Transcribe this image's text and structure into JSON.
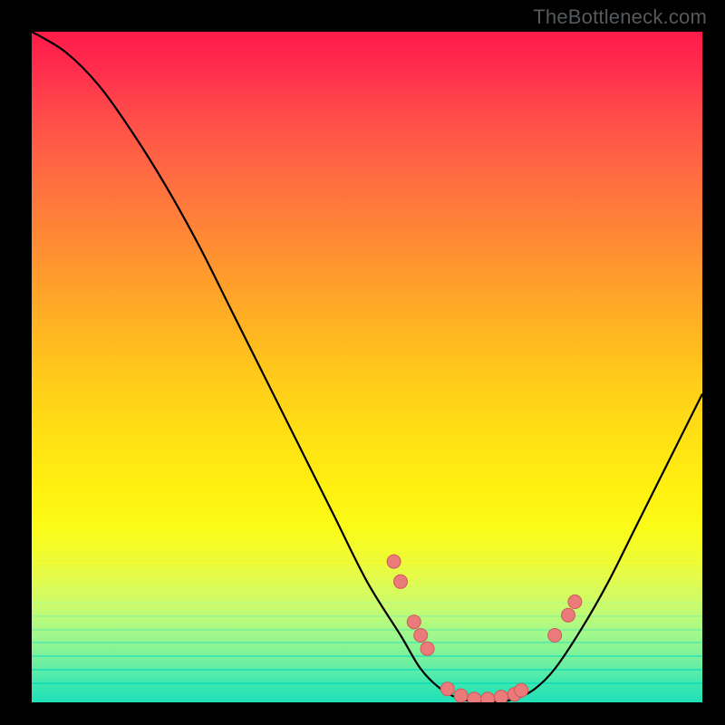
{
  "watermark": "TheBottleneck.com",
  "chart_data": {
    "type": "line",
    "title": "",
    "xlabel": "",
    "ylabel": "",
    "xlim": [
      0,
      100
    ],
    "ylim": [
      0,
      100
    ],
    "grid": false,
    "curve": [
      {
        "x": 0,
        "y": 100
      },
      {
        "x": 5,
        "y": 97
      },
      {
        "x": 10,
        "y": 92
      },
      {
        "x": 15,
        "y": 85
      },
      {
        "x": 20,
        "y": 77
      },
      {
        "x": 25,
        "y": 68
      },
      {
        "x": 30,
        "y": 58
      },
      {
        "x": 35,
        "y": 48
      },
      {
        "x": 40,
        "y": 38
      },
      {
        "x": 45,
        "y": 28
      },
      {
        "x": 50,
        "y": 18
      },
      {
        "x": 55,
        "y": 10
      },
      {
        "x": 58,
        "y": 5
      },
      {
        "x": 61,
        "y": 2
      },
      {
        "x": 64,
        "y": 0.5
      },
      {
        "x": 68,
        "y": 0
      },
      {
        "x": 72,
        "y": 0.5
      },
      {
        "x": 75,
        "y": 2
      },
      {
        "x": 78,
        "y": 5
      },
      {
        "x": 82,
        "y": 11
      },
      {
        "x": 86,
        "y": 18
      },
      {
        "x": 90,
        "y": 26
      },
      {
        "x": 95,
        "y": 36
      },
      {
        "x": 100,
        "y": 46
      }
    ],
    "markers": [
      {
        "x": 54,
        "y": 21
      },
      {
        "x": 55,
        "y": 18
      },
      {
        "x": 57,
        "y": 12
      },
      {
        "x": 58,
        "y": 10
      },
      {
        "x": 59,
        "y": 8
      },
      {
        "x": 62,
        "y": 2
      },
      {
        "x": 64,
        "y": 1
      },
      {
        "x": 66,
        "y": 0.5
      },
      {
        "x": 68,
        "y": 0.5
      },
      {
        "x": 70,
        "y": 0.8
      },
      {
        "x": 72,
        "y": 1.2
      },
      {
        "x": 73,
        "y": 1.8
      },
      {
        "x": 78,
        "y": 10
      },
      {
        "x": 80,
        "y": 13
      },
      {
        "x": 81,
        "y": 15
      }
    ],
    "gradient_stops": [
      {
        "pct": 0,
        "color": "#ff1a4a"
      },
      {
        "pct": 20,
        "color": "#ff6743"
      },
      {
        "pct": 40,
        "color": "#ffb322"
      },
      {
        "pct": 60,
        "color": "#ffe014"
      },
      {
        "pct": 80,
        "color": "#e0fb50"
      },
      {
        "pct": 100,
        "color": "#20e0b8"
      }
    ],
    "lower_band_lines": [
      {
        "y": 79,
        "color": "#f6fb30"
      },
      {
        "y": 81,
        "color": "#eafb48"
      },
      {
        "y": 83,
        "color": "#d8fb60"
      },
      {
        "y": 85,
        "color": "#c0fb78"
      },
      {
        "y": 87,
        "color": "#a0f88c"
      },
      {
        "y": 89,
        "color": "#80f298"
      },
      {
        "y": 91,
        "color": "#60eca4"
      },
      {
        "y": 93,
        "color": "#40e6ae"
      },
      {
        "y": 95,
        "color": "#28e2b4"
      },
      {
        "y": 97,
        "color": "#18deb8"
      }
    ]
  }
}
